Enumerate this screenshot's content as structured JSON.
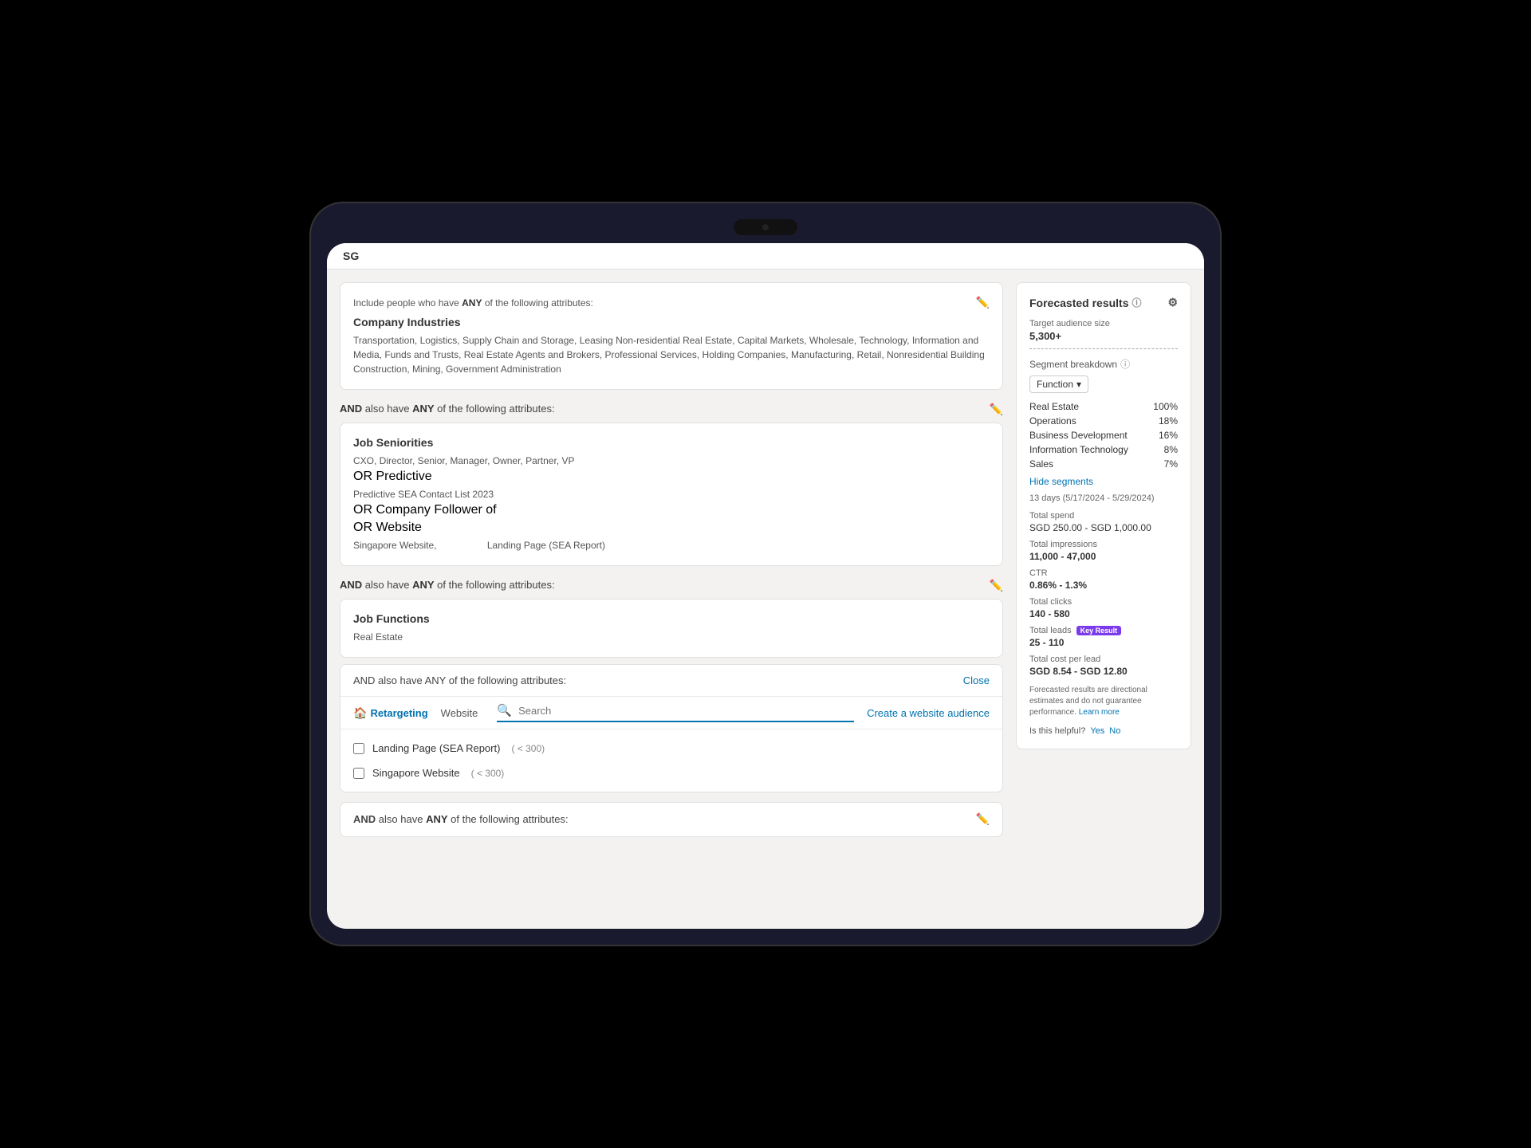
{
  "device": {
    "logo": "SG"
  },
  "audience_builder": {
    "include_text": "Include people who have",
    "any_label": "ANY",
    "following_attributes": "of the following attributes:",
    "company_industries": {
      "title": "Company Industries",
      "values": "Transportation, Logistics, Supply Chain and Storage, Leasing Non-residential Real Estate, Capital Markets, Wholesale, Technology, Information and Media, Funds and Trusts, Real Estate Agents and Brokers, Professional Services, Holding Companies, Manufacturing, Retail, Nonresidential Building Construction, Mining, Government Administration"
    },
    "and_connector": "AND",
    "also_have": "also have",
    "job_seniorities": {
      "title": "Job Seniorities",
      "values": "CXO, Director, Senior, Manager, Owner, Partner, VP"
    },
    "or_predictive": {
      "label": "OR Predictive",
      "value": "Predictive SEA Contact List 2023"
    },
    "or_company_follower": {
      "label": "OR Company Follower of"
    },
    "or_website": {
      "label": "OR Website",
      "values": [
        "Singapore Website,",
        "Landing Page (SEA Report)"
      ]
    },
    "job_functions": {
      "title": "Job Functions",
      "value": "Real Estate"
    },
    "and_also_have_any_connector": "AND also have ANY of the following attributes:",
    "search_section": {
      "header": "AND also have ANY of the following attributes:",
      "close_btn": "Close",
      "tabs": [
        {
          "label": "Retargeting",
          "active": false,
          "icon": "🏠"
        },
        {
          "label": "Website",
          "active": false
        }
      ],
      "search_placeholder": "Search",
      "create_audience_link": "Create a website audience",
      "items": [
        {
          "label": "Landing Page (SEA Report)",
          "count": "< 300",
          "checked": false
        },
        {
          "label": "Singapore Website",
          "count": "< 300",
          "checked": false
        }
      ]
    }
  },
  "forecast": {
    "title": "Forecasted results",
    "target_audience_label": "Target audience size",
    "target_audience_value": "5,300+",
    "segment_breakdown_label": "Segment breakdown",
    "segment_dropdown": "Function",
    "segments": [
      {
        "label": "Real Estate",
        "pct": "100%"
      },
      {
        "label": "Operations",
        "pct": "18%"
      },
      {
        "label": "Business Development",
        "pct": "16%"
      },
      {
        "label": "Information Technology",
        "pct": "8%"
      },
      {
        "label": "Sales",
        "pct": "7%"
      }
    ],
    "hide_segments_label": "Hide segments",
    "date_range": "13 days (5/17/2024 - 5/29/2024)",
    "total_spend_label": "Total spend",
    "total_spend_value": "SGD 250.00 - SGD 1,000.00",
    "total_impressions_label": "Total impressions",
    "total_impressions_value": "11,000 - 47,000",
    "ctr_label": "CTR",
    "ctr_value": "0.86% - 1.3%",
    "total_clicks_label": "Total clicks",
    "total_clicks_value": "140 - 580",
    "total_leads_label": "Total leads",
    "key_result_badge": "Key Result",
    "total_leads_value": "25 - 110",
    "cost_per_lead_label": "Total cost per lead",
    "cost_per_lead_value": "SGD 8.54 - SGD 12.80",
    "disclaimer": "Forecasted results are directional estimates and do not guarantee performance.",
    "learn_more": "Learn more",
    "helpful_text": "Is this helpful?",
    "yes_text": "Yes",
    "no_text": "No"
  }
}
